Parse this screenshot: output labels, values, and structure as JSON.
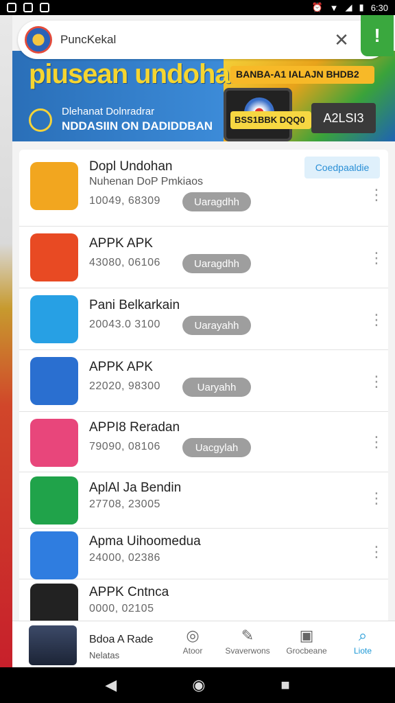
{
  "status": {
    "time": "6:30"
  },
  "search": {
    "text": "PuncKekal"
  },
  "banner": {
    "title": "piusean undohan",
    "sub1": "Dlehanat Dolnradrar",
    "sub2": "NDDASIIN ON DADIDDBAN",
    "top_pill": "BANBA-A1 IALAJN BHDB2",
    "bottom_pill": "BSS1BBK DQQ0",
    "cta": "A2LSI3"
  },
  "list": [
    {
      "name": "Dopl Undohan",
      "sub": "Nuhenan DoP Pmkiaos",
      "meta": "10049, 68309",
      "pill": "Uaragdhh",
      "status": "Coedpaaldie",
      "color": "#f2a61f"
    },
    {
      "name": "APPK APK",
      "sub": "",
      "meta": "43080, 06106",
      "pill": "Uaragdhh",
      "color": "#e84a23"
    },
    {
      "name": "Pani Belkarkain",
      "sub": "",
      "meta": "20043.0 3100",
      "pill": "Uarayahh",
      "color": "#27a0e4"
    },
    {
      "name": "APPK APK",
      "sub": "",
      "meta": "22020, 98300",
      "pill": "Uaryahh",
      "color": "#2a6fd0"
    },
    {
      "name": "APPI8 Reradan",
      "sub": "",
      "meta": "79090, 08106",
      "pill": "Uacgylah",
      "color": "#e8467b"
    },
    {
      "name": "AplAl Ja Bendin",
      "sub": "",
      "meta": "27708, 23005",
      "pill": "",
      "color": "#20a34a"
    },
    {
      "name": "Apma Uihoomedua",
      "sub": "",
      "meta": "24000, 02386",
      "pill": "",
      "color": "#2f7de0"
    },
    {
      "name": "APPK Cntnca",
      "sub": "",
      "meta": "0000, 02105",
      "pill": "",
      "color": "#222222"
    }
  ],
  "bottomnav": {
    "title": "Bdoa A Rade",
    "sub": "Nelatas",
    "items": [
      {
        "label": "Atoor"
      },
      {
        "label": "Svaverwons"
      },
      {
        "label": "Grocbeane"
      },
      {
        "label": "Liote"
      }
    ]
  }
}
